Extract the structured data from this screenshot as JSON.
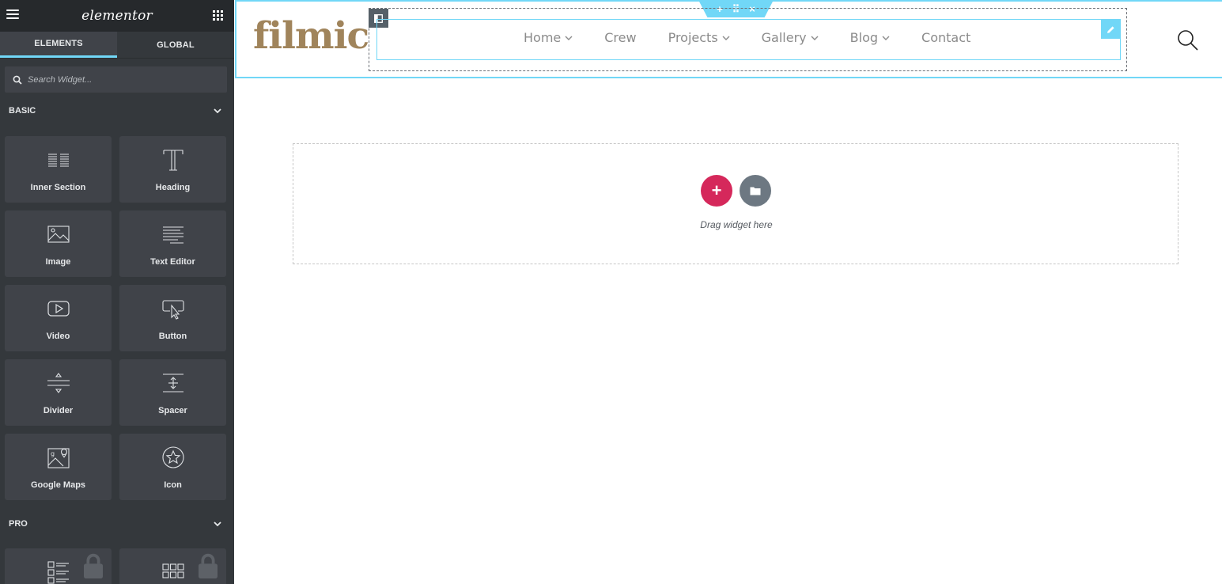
{
  "sidebar": {
    "brand": "elementor",
    "tabs": [
      {
        "label": "ELEMENTS",
        "active": true
      },
      {
        "label": "GLOBAL",
        "active": false
      }
    ],
    "search": {
      "placeholder": "Search Widget..."
    },
    "categories": {
      "basic": {
        "label": "BASIC",
        "widgets": [
          {
            "label": "Inner Section",
            "icon": "inner-section-icon"
          },
          {
            "label": "Heading",
            "icon": "heading-icon"
          },
          {
            "label": "Image",
            "icon": "image-icon"
          },
          {
            "label": "Text Editor",
            "icon": "text-editor-icon"
          },
          {
            "label": "Video",
            "icon": "video-icon"
          },
          {
            "label": "Button",
            "icon": "button-icon"
          },
          {
            "label": "Divider",
            "icon": "divider-icon"
          },
          {
            "label": "Spacer",
            "icon": "spacer-icon"
          },
          {
            "label": "Google Maps",
            "icon": "google-maps-icon"
          },
          {
            "label": "Icon",
            "icon": "star-icon"
          }
        ]
      },
      "pro": {
        "label": "PRO",
        "widgets": [
          {
            "icon": "posts-icon",
            "locked": true
          },
          {
            "icon": "portfolio-icon",
            "locked": true
          }
        ]
      }
    }
  },
  "canvas": {
    "logo": "filmic",
    "nav": [
      {
        "label": "Home",
        "has_dropdown": true
      },
      {
        "label": "Crew",
        "has_dropdown": false
      },
      {
        "label": "Projects",
        "has_dropdown": true
      },
      {
        "label": "Gallery",
        "has_dropdown": true
      },
      {
        "label": "Blog",
        "has_dropdown": true
      },
      {
        "label": "Contact",
        "has_dropdown": false
      }
    ],
    "section_controls": {
      "add": "+",
      "move": "⠿",
      "close": "×"
    },
    "dropzone": {
      "add_label": "+",
      "text": "Drag widget here"
    }
  },
  "colors": {
    "sidebar_bg": "#34383c",
    "panel_tile": "#404349",
    "accent": "#71d7f7",
    "add_button": "#d5285b",
    "logo": "#a0845b"
  }
}
